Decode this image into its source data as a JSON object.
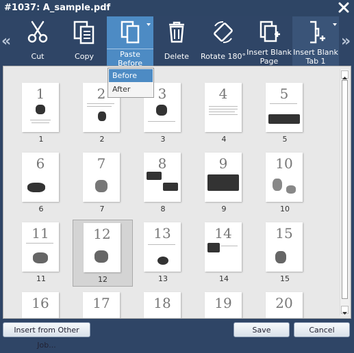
{
  "window": {
    "title": "#1037: A_sample.pdf"
  },
  "toolbar": {
    "buttons": [
      {
        "label": "Cut",
        "icon": "scissors-icon"
      },
      {
        "label": "Copy",
        "icon": "copy-icon"
      },
      {
        "label": "Paste Before",
        "icon": "paste-icon"
      },
      {
        "label": "Delete",
        "icon": "trash-icon"
      },
      {
        "label": "Rotate 180°",
        "icon": "rotate-icon"
      },
      {
        "label": "Insert Blank Page",
        "icon": "insert-page-icon"
      },
      {
        "label": "Insert Blank Tab 1",
        "icon": "insert-tab-icon"
      }
    ]
  },
  "paste_menu": {
    "items": [
      "Before",
      "After"
    ],
    "selected": "Before"
  },
  "pages": {
    "labels": [
      "1",
      "2",
      "3",
      "4",
      "5",
      "6",
      "7",
      "8",
      "9",
      "10",
      "11",
      "12",
      "13",
      "14",
      "15",
      "16",
      "17",
      "18",
      "19",
      "20"
    ],
    "selected": "12"
  },
  "footer": {
    "insert_label": "Insert from Other Job...",
    "save_label": "Save",
    "cancel_label": "Cancel"
  },
  "colors": {
    "chrome": "#2f4566",
    "accent": "#4d8bc4"
  }
}
